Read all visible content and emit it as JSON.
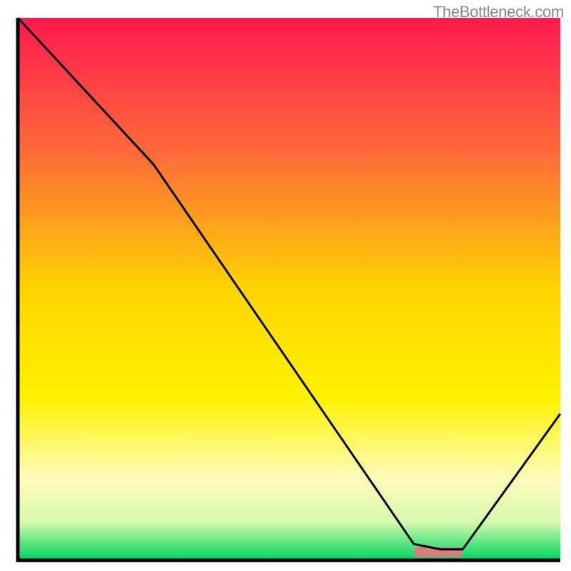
{
  "watermark": "TheBottleneck.com",
  "chart_data": {
    "type": "line",
    "title": "",
    "xlabel": "",
    "ylabel": "",
    "xlim": [
      0,
      100
    ],
    "ylim": [
      0,
      100
    ],
    "x": [
      0,
      25,
      73,
      78,
      82,
      100
    ],
    "values": [
      100,
      73,
      3,
      2,
      2,
      27
    ],
    "marker_band": {
      "x_start": 73,
      "x_end": 82,
      "y": 1.5,
      "color": "#d67f7e"
    },
    "background_gradient": {
      "stops": [
        {
          "offset": 0.0,
          "color": "#ff1a4f"
        },
        {
          "offset": 0.25,
          "color": "#ff6b3a"
        },
        {
          "offset": 0.5,
          "color": "#ffd400"
        },
        {
          "offset": 0.7,
          "color": "#fff200"
        },
        {
          "offset": 0.85,
          "color": "#fffcbb"
        },
        {
          "offset": 0.93,
          "color": "#d6f9b0"
        },
        {
          "offset": 0.97,
          "color": "#55e57e"
        },
        {
          "offset": 1.0,
          "color": "#00d463"
        }
      ]
    },
    "axis_color": "#000000",
    "line_color": "#000000"
  }
}
